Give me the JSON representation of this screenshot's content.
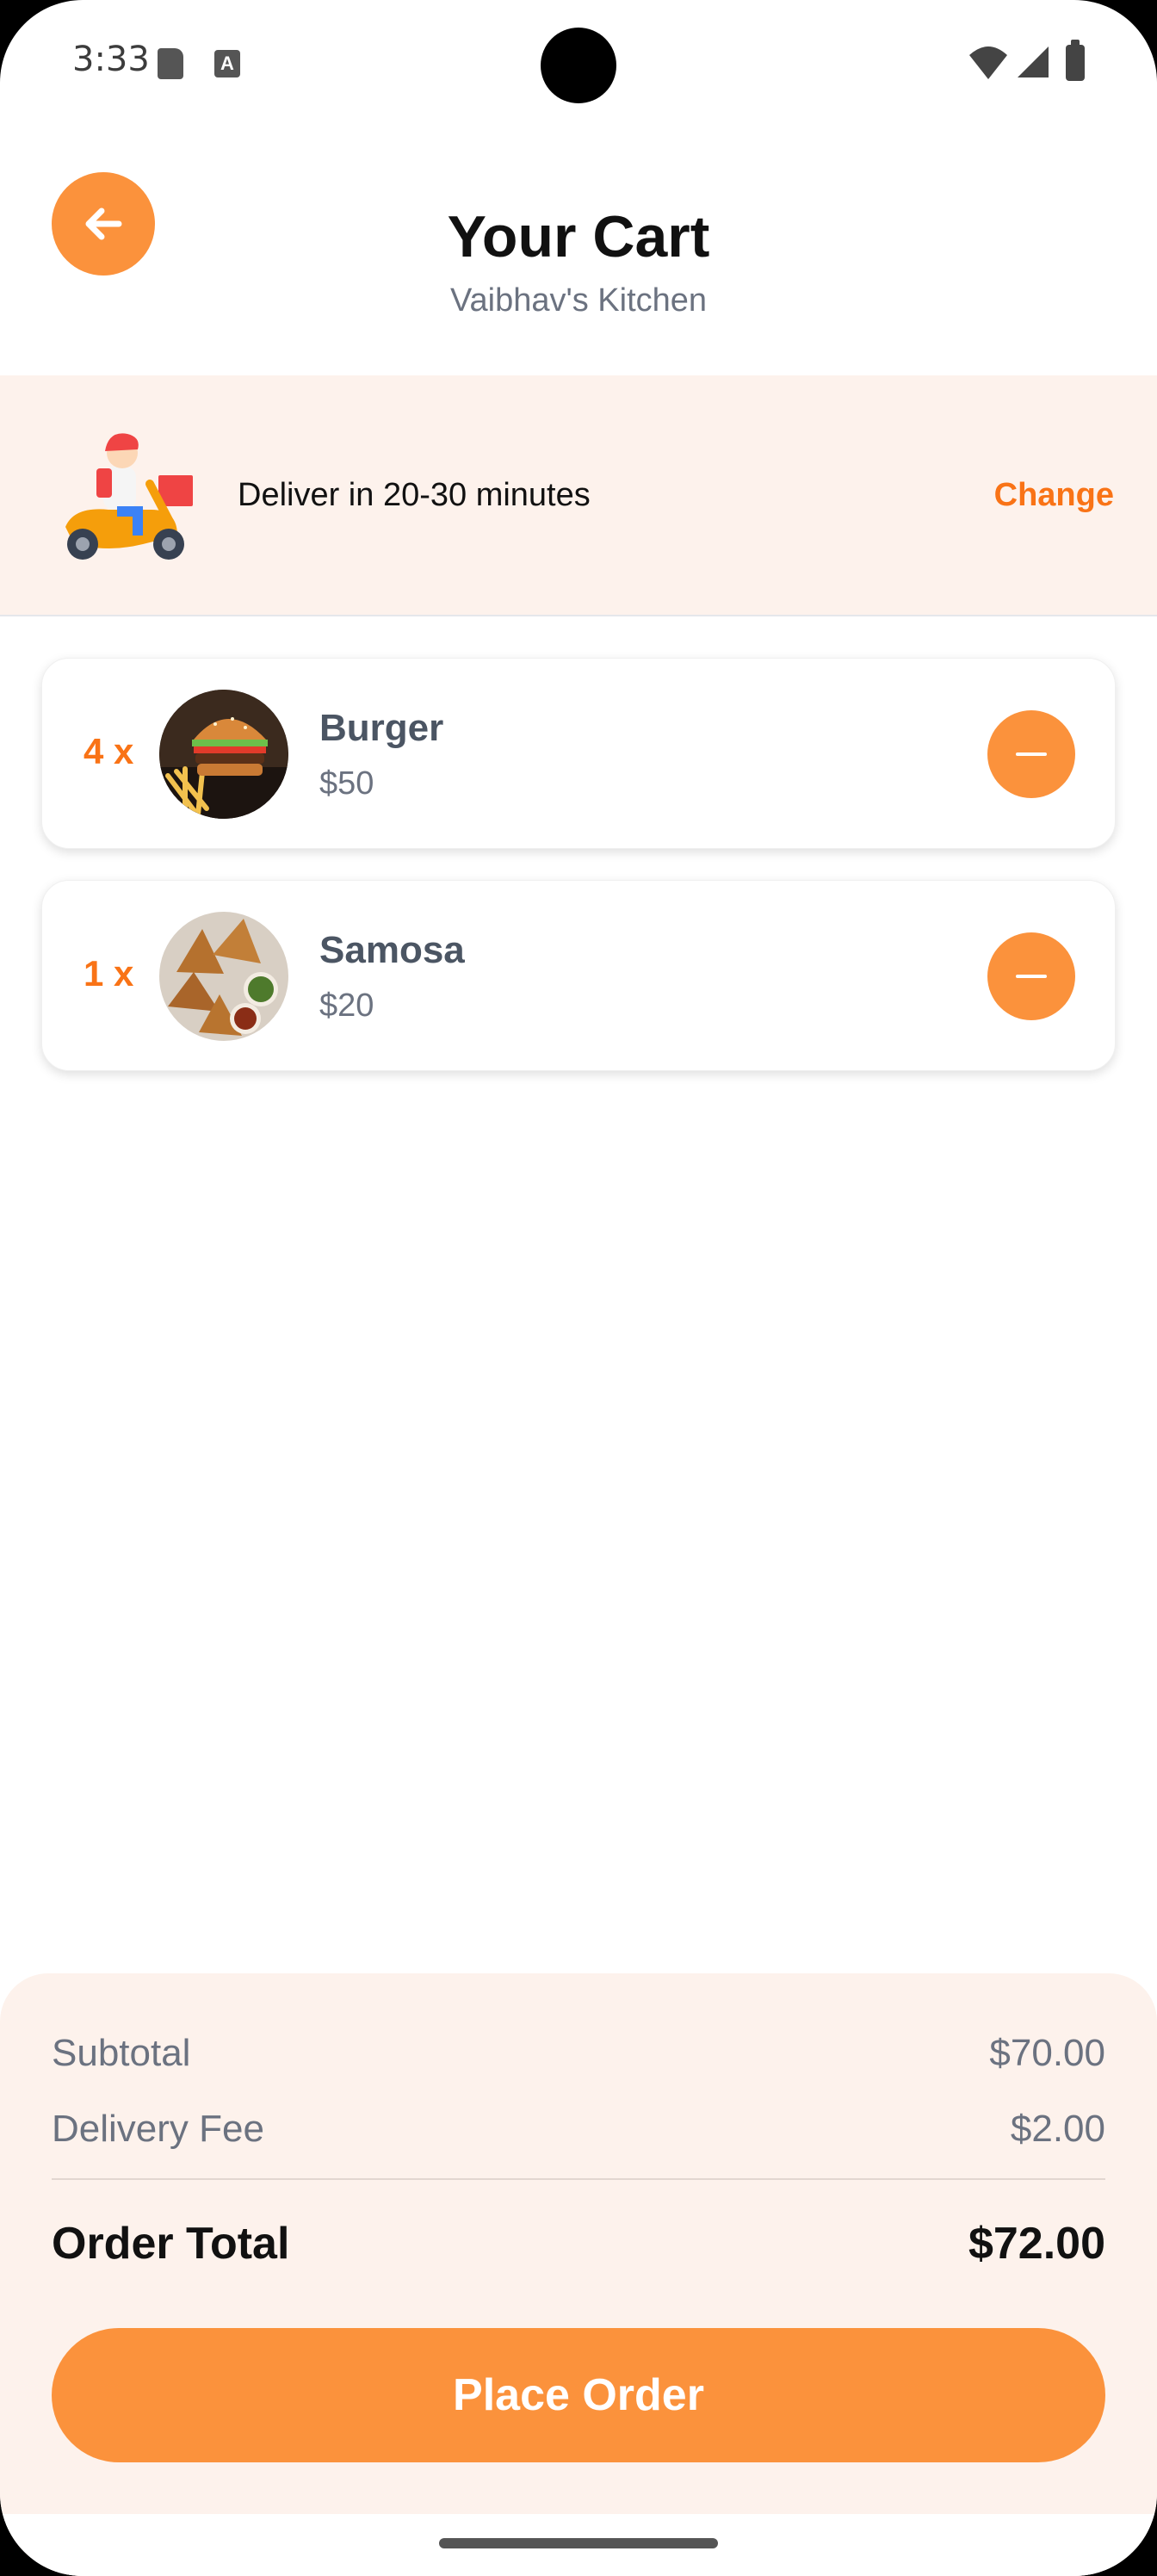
{
  "status_bar": {
    "time": "3:33",
    "icons": [
      "sd-card-icon",
      "font-icon",
      "wifi-icon",
      "signal-icon",
      "battery-icon"
    ]
  },
  "header": {
    "back_icon": "arrow-left-icon",
    "title": "Your Cart",
    "subtitle": "Vaibhav's Kitchen"
  },
  "delivery": {
    "illustration": "delivery-scooter-illustration",
    "text": "Deliver in 20-30 minutes",
    "change_label": "Change"
  },
  "cart": {
    "items": [
      {
        "quantity": "4 x",
        "name": "Burger",
        "price": "$50",
        "image": "burger-photo",
        "remove_icon": "minus-icon"
      },
      {
        "quantity": "1 x",
        "name": "Samosa",
        "price": "$20",
        "image": "samosa-photo",
        "remove_icon": "minus-icon"
      }
    ]
  },
  "summary": {
    "subtotal_label": "Subtotal",
    "subtotal_value": "$70.00",
    "delivery_fee_label": "Delivery Fee",
    "delivery_fee_value": "$2.00",
    "total_label": "Order Total",
    "total_value": "$72.00",
    "place_order_label": "Place Order"
  },
  "colors": {
    "accent": "#fb923c",
    "accent_text": "#f97316",
    "panel_bg": "#fdf2ec"
  }
}
